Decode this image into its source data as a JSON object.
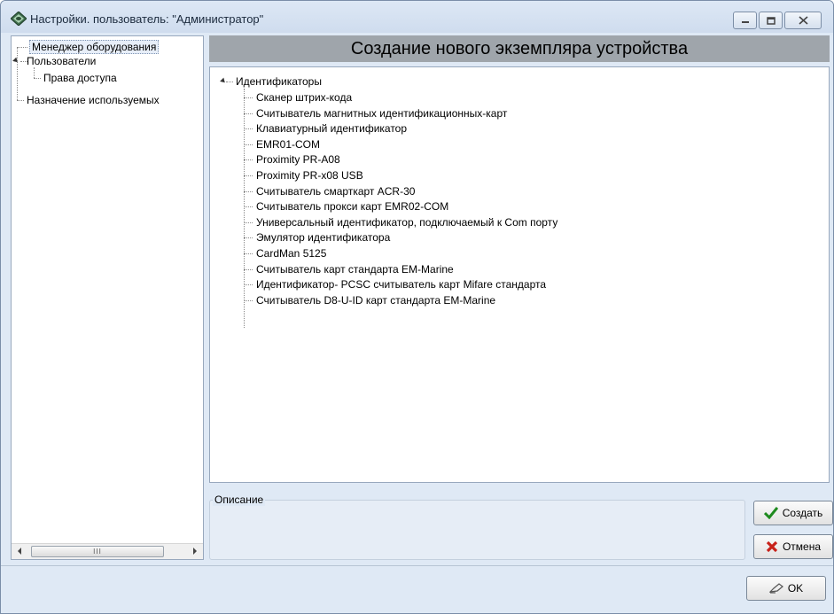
{
  "window": {
    "title": "Настройки. пользователь: \"Администратор\""
  },
  "nav_tree": {
    "items": [
      {
        "label": "Менеджер оборудования",
        "selected": true
      },
      {
        "label": "Пользователи",
        "expanded": true
      },
      {
        "label": "Права доступа"
      },
      {
        "label": "Назначение используемых"
      }
    ],
    "scrollbar_grip": "III"
  },
  "main": {
    "header": "Создание нового экземпляра устройства",
    "tree_root": "Идентификаторы",
    "devices": [
      "Сканер штрих-кода",
      "Считыватель магнитных идентификационных-карт",
      "Клавиатурный идентификатор",
      "EMR01-COM",
      "Proximity PR-A08",
      "Proximity PR-x08 USB",
      "Считыватель смарткарт ACR-30",
      "Считыватель прокси карт EMR02-COM",
      "Универсальный идентификатор, подключаемый к Com порту",
      "Эмулятор идентификатора",
      "CardMan 5125",
      "Считыватель карт стандарта EM-Marine",
      "Идентификатор- PCSC считыватель карт Mifare стандарта",
      "Считыватель D8-U-ID карт стандарта EM-Marine"
    ],
    "description_label": "Описание"
  },
  "buttons": {
    "create": "Создать",
    "cancel": "Отмена",
    "ok": "OK"
  },
  "colors": {
    "window_bg": "#dfe9f5",
    "header_bg": "#9fa5ab",
    "check_green": "#1e8a1e",
    "cancel_red": "#c8221a"
  }
}
